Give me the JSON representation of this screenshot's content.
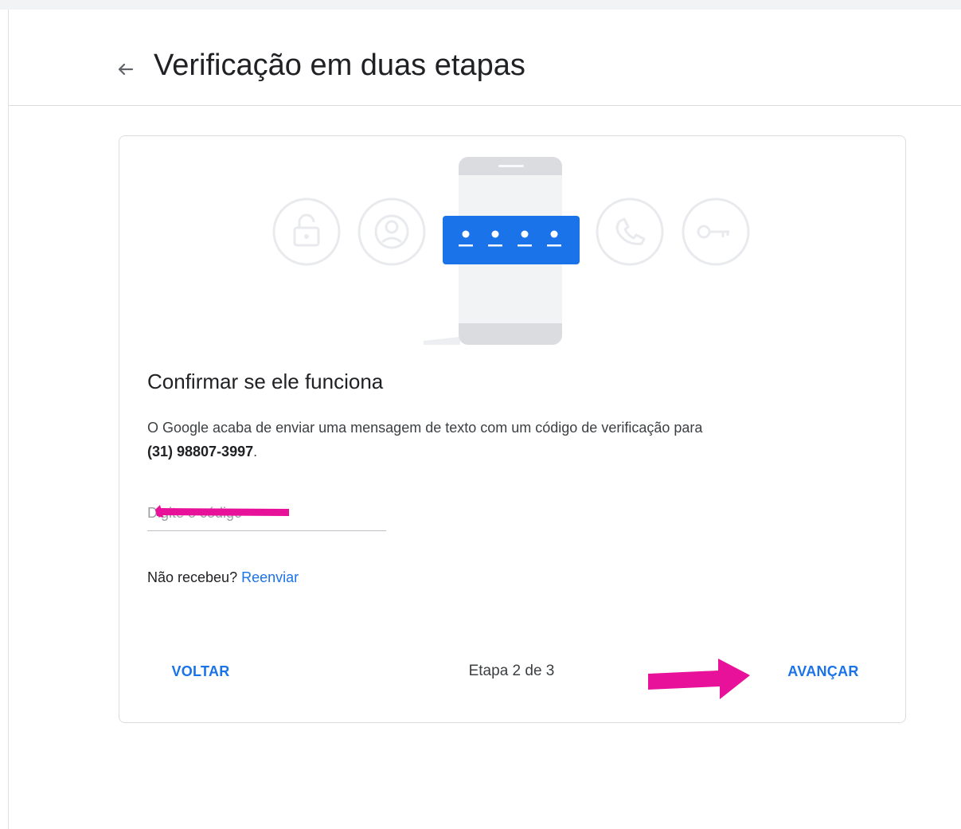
{
  "page": {
    "title": "Verificação em duas etapas",
    "back_icon": "arrow-left-icon"
  },
  "card": {
    "illustration_icons": [
      "lock-icon",
      "account-circle-icon",
      "phone-icon",
      "key-icon"
    ],
    "heading": "Confirmar se ele funciona",
    "message_text": "O Google acaba de enviar uma mensagem de texto com um código de verificação para",
    "phone_number": "(31) 98807-3997",
    "message_end": ".",
    "code_input": {
      "value": "",
      "placeholder": "Digite o código"
    },
    "resend_prompt": "Não recebeu?",
    "resend_link": "Reenviar"
  },
  "footer": {
    "back_label": "VOLTAR",
    "step_text": "Etapa 2 de 3",
    "next_label": "AVANÇAR"
  },
  "colors": {
    "accent": "#1a73e8",
    "annotation": "#e8119a",
    "text": "#202124"
  }
}
